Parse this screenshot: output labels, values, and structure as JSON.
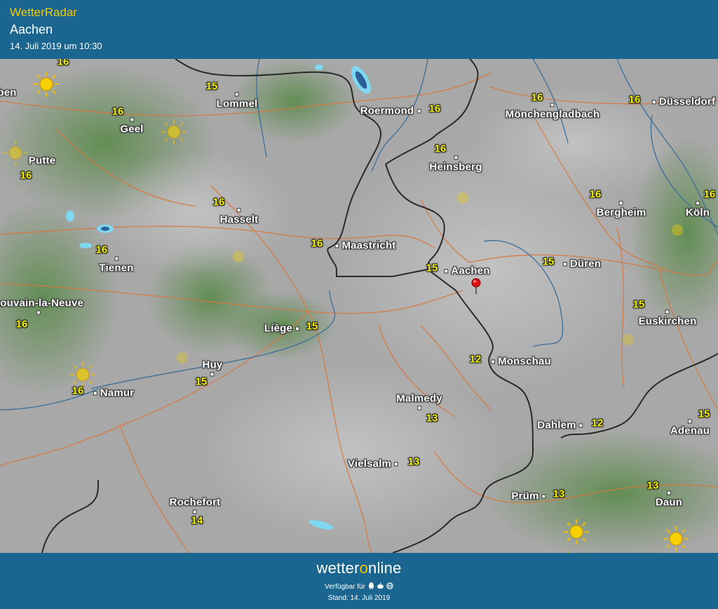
{
  "header": {
    "app_title": "WetterRadar",
    "location": "Aachen",
    "timestamp": "14. Juli 2019 um 10:30"
  },
  "map": {
    "cities": [
      {
        "name": "Lommel",
        "temp": "15"
      },
      {
        "name": "Geel",
        "temp": "16"
      },
      {
        "name": "Putte",
        "temp": "16"
      },
      {
        "name": "Roermond",
        "temp": "16"
      },
      {
        "name": "Mönchengladbach",
        "temp": "16"
      },
      {
        "name": "Düsseldorf",
        "temp": "16"
      },
      {
        "name": "Heinsberg",
        "temp": "16"
      },
      {
        "name": "Hasselt",
        "temp": "16"
      },
      {
        "name": "Maastricht",
        "temp": "16"
      },
      {
        "name": "Tienen",
        "temp": "16"
      },
      {
        "name": "Bergheim",
        "temp": "16"
      },
      {
        "name": "Köln",
        "temp": "16"
      },
      {
        "name": "Aachen",
        "temp": "15"
      },
      {
        "name": "Düren",
        "temp": "15"
      },
      {
        "name": "Louvain-la-Neuve",
        "temp": "16"
      },
      {
        "name": "Euskirchen",
        "temp": "15"
      },
      {
        "name": "Liège",
        "temp": "15"
      },
      {
        "name": "Huy",
        "temp": "15"
      },
      {
        "name": "Monschau",
        "temp": "12"
      },
      {
        "name": "Namur",
        "temp": "16"
      },
      {
        "name": "Malmedy",
        "temp": "13"
      },
      {
        "name": "Dahlem",
        "temp": "12"
      },
      {
        "name": "Adenau",
        "temp": "15"
      },
      {
        "name": "Vielsalm",
        "temp": "13"
      },
      {
        "name": "Rochefort",
        "temp": "14"
      },
      {
        "name": "Prüm",
        "temp": "13"
      },
      {
        "name": "Daun",
        "temp": "13"
      }
    ],
    "extra_temps": [
      "16"
    ],
    "partial_labels": [
      "ben"
    ],
    "icons": [
      "sun-icon",
      "location-pin-icon"
    ],
    "colors": {
      "header_bg": "#1a6690",
      "accent": "#f7c900",
      "temp": "#f3f000",
      "road": "#d7773c",
      "river": "#3a6f9a",
      "border": "#2a2a2a"
    }
  },
  "footer": {
    "brand_prefix": "wetter",
    "brand_accent": "o",
    "brand_suffix": "nline",
    "availability": "Verfügbar für",
    "platforms": [
      "android-icon",
      "apple-icon",
      "web-icon"
    ],
    "stand": "Stand: 14. Juli 2019"
  }
}
